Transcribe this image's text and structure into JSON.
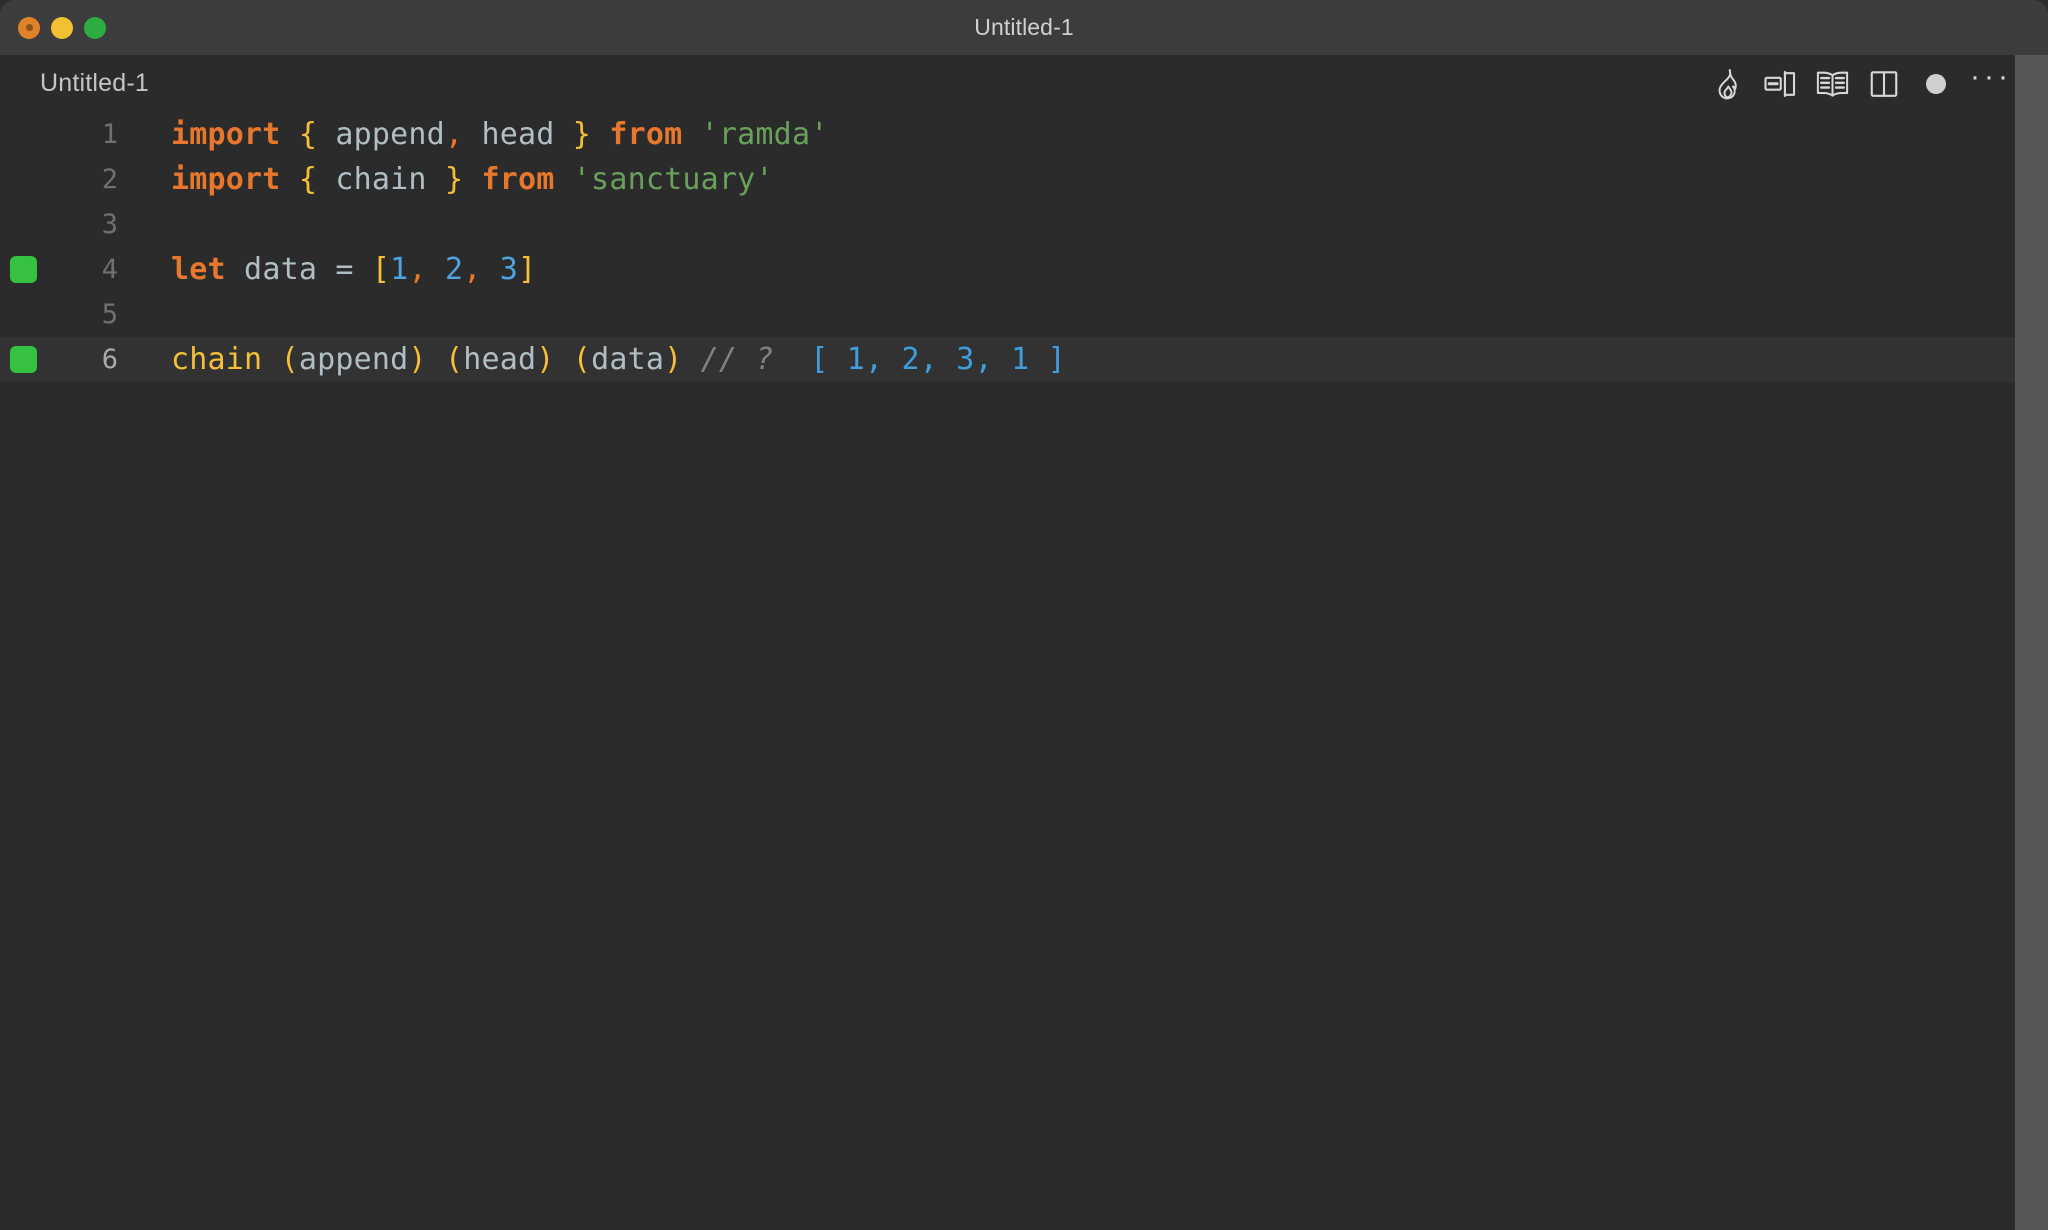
{
  "window": {
    "title": "Untitled-1",
    "traffic_lights": [
      {
        "name": "close",
        "color": "#e0822a"
      },
      {
        "name": "minimize",
        "color": "#f2c032"
      },
      {
        "name": "maximize",
        "color": "#2dac3f"
      }
    ]
  },
  "editor": {
    "tab_label": "Untitled-1",
    "toolbar": [
      {
        "icon": "flame-icon",
        "title": "Quokka"
      },
      {
        "icon": "open-changes-icon",
        "title": "Open Changes"
      },
      {
        "icon": "open-book-icon",
        "title": "Open Preview"
      },
      {
        "icon": "split-editor-icon",
        "title": "Split Editor"
      },
      {
        "icon": "unsaved-dot-icon",
        "title": "Unsaved Changes"
      },
      {
        "icon": "ellipsis-icon",
        "title": "More Actions...",
        "label": "···"
      }
    ]
  },
  "code": {
    "language": "javascript",
    "active_line": 6,
    "lines": [
      {
        "number": "1",
        "marker": false,
        "active": false,
        "tokens": [
          {
            "t": "import",
            "c": "t-kw"
          },
          {
            "t": " ",
            "c": "t-op"
          },
          {
            "t": "{",
            "c": "t-brace"
          },
          {
            "t": " append",
            "c": "t-ident"
          },
          {
            "t": ",",
            "c": "t-punct"
          },
          {
            "t": " head ",
            "c": "t-ident"
          },
          {
            "t": "}",
            "c": "t-brace"
          },
          {
            "t": " ",
            "c": "t-op"
          },
          {
            "t": "from",
            "c": "t-kw"
          },
          {
            "t": " ",
            "c": "t-op"
          },
          {
            "t": "'ramda'",
            "c": "t-str"
          }
        ]
      },
      {
        "number": "2",
        "marker": false,
        "active": false,
        "tokens": [
          {
            "t": "import",
            "c": "t-kw"
          },
          {
            "t": " ",
            "c": "t-op"
          },
          {
            "t": "{",
            "c": "t-brace"
          },
          {
            "t": " chain ",
            "c": "t-ident"
          },
          {
            "t": "}",
            "c": "t-brace"
          },
          {
            "t": " ",
            "c": "t-op"
          },
          {
            "t": "from",
            "c": "t-kw"
          },
          {
            "t": " ",
            "c": "t-op"
          },
          {
            "t": "'sanctuary'",
            "c": "t-str"
          }
        ]
      },
      {
        "number": "3",
        "marker": false,
        "active": false,
        "tokens": []
      },
      {
        "number": "4",
        "marker": true,
        "active": false,
        "tokens": [
          {
            "t": "let",
            "c": "t-kw"
          },
          {
            "t": " data ",
            "c": "t-ident"
          },
          {
            "t": "=",
            "c": "t-op"
          },
          {
            "t": " ",
            "c": "t-op"
          },
          {
            "t": "[",
            "c": "t-brace"
          },
          {
            "t": "1",
            "c": "t-num"
          },
          {
            "t": ",",
            "c": "t-punct"
          },
          {
            "t": " ",
            "c": "t-op"
          },
          {
            "t": "2",
            "c": "t-num"
          },
          {
            "t": ",",
            "c": "t-punct"
          },
          {
            "t": " ",
            "c": "t-op"
          },
          {
            "t": "3",
            "c": "t-num"
          },
          {
            "t": "]",
            "c": "t-brace"
          }
        ]
      },
      {
        "number": "5",
        "marker": false,
        "active": false,
        "tokens": []
      },
      {
        "number": "6",
        "marker": true,
        "active": true,
        "tokens": [
          {
            "t": "chain",
            "c": "t-fn"
          },
          {
            "t": " ",
            "c": "t-op"
          },
          {
            "t": "(",
            "c": "t-brace"
          },
          {
            "t": "append",
            "c": "t-ident"
          },
          {
            "t": ")",
            "c": "t-brace"
          },
          {
            "t": " ",
            "c": "t-op"
          },
          {
            "t": "(",
            "c": "t-brace"
          },
          {
            "t": "head",
            "c": "t-ident"
          },
          {
            "t": ")",
            "c": "t-brace"
          },
          {
            "t": " ",
            "c": "t-op"
          },
          {
            "t": "(",
            "c": "t-brace"
          },
          {
            "t": "data",
            "c": "t-ident"
          },
          {
            "t": ")",
            "c": "t-brace"
          },
          {
            "t": " ",
            "c": "t-op"
          },
          {
            "t": "// ?",
            "c": "t-comment"
          },
          {
            "t": "  ",
            "c": "t-op"
          },
          {
            "t": "[ 1, 2, 3, 1 ]",
            "c": "t-result"
          }
        ]
      }
    ]
  },
  "colors": {
    "background": "#2b2b2b",
    "titlebar": "#3c3c3c",
    "active_line": "#323232",
    "keyword": "#e8772e",
    "brace": "#f5c038",
    "identifier": "#b0bec5",
    "string": "#69a05b",
    "number": "#4ea3e0",
    "comment": "#7e8285",
    "quokka_result": "#3f9fdd",
    "gutter_marker": "#34c240",
    "line_number": "#6e7174",
    "scrollbar": "#575757"
  }
}
